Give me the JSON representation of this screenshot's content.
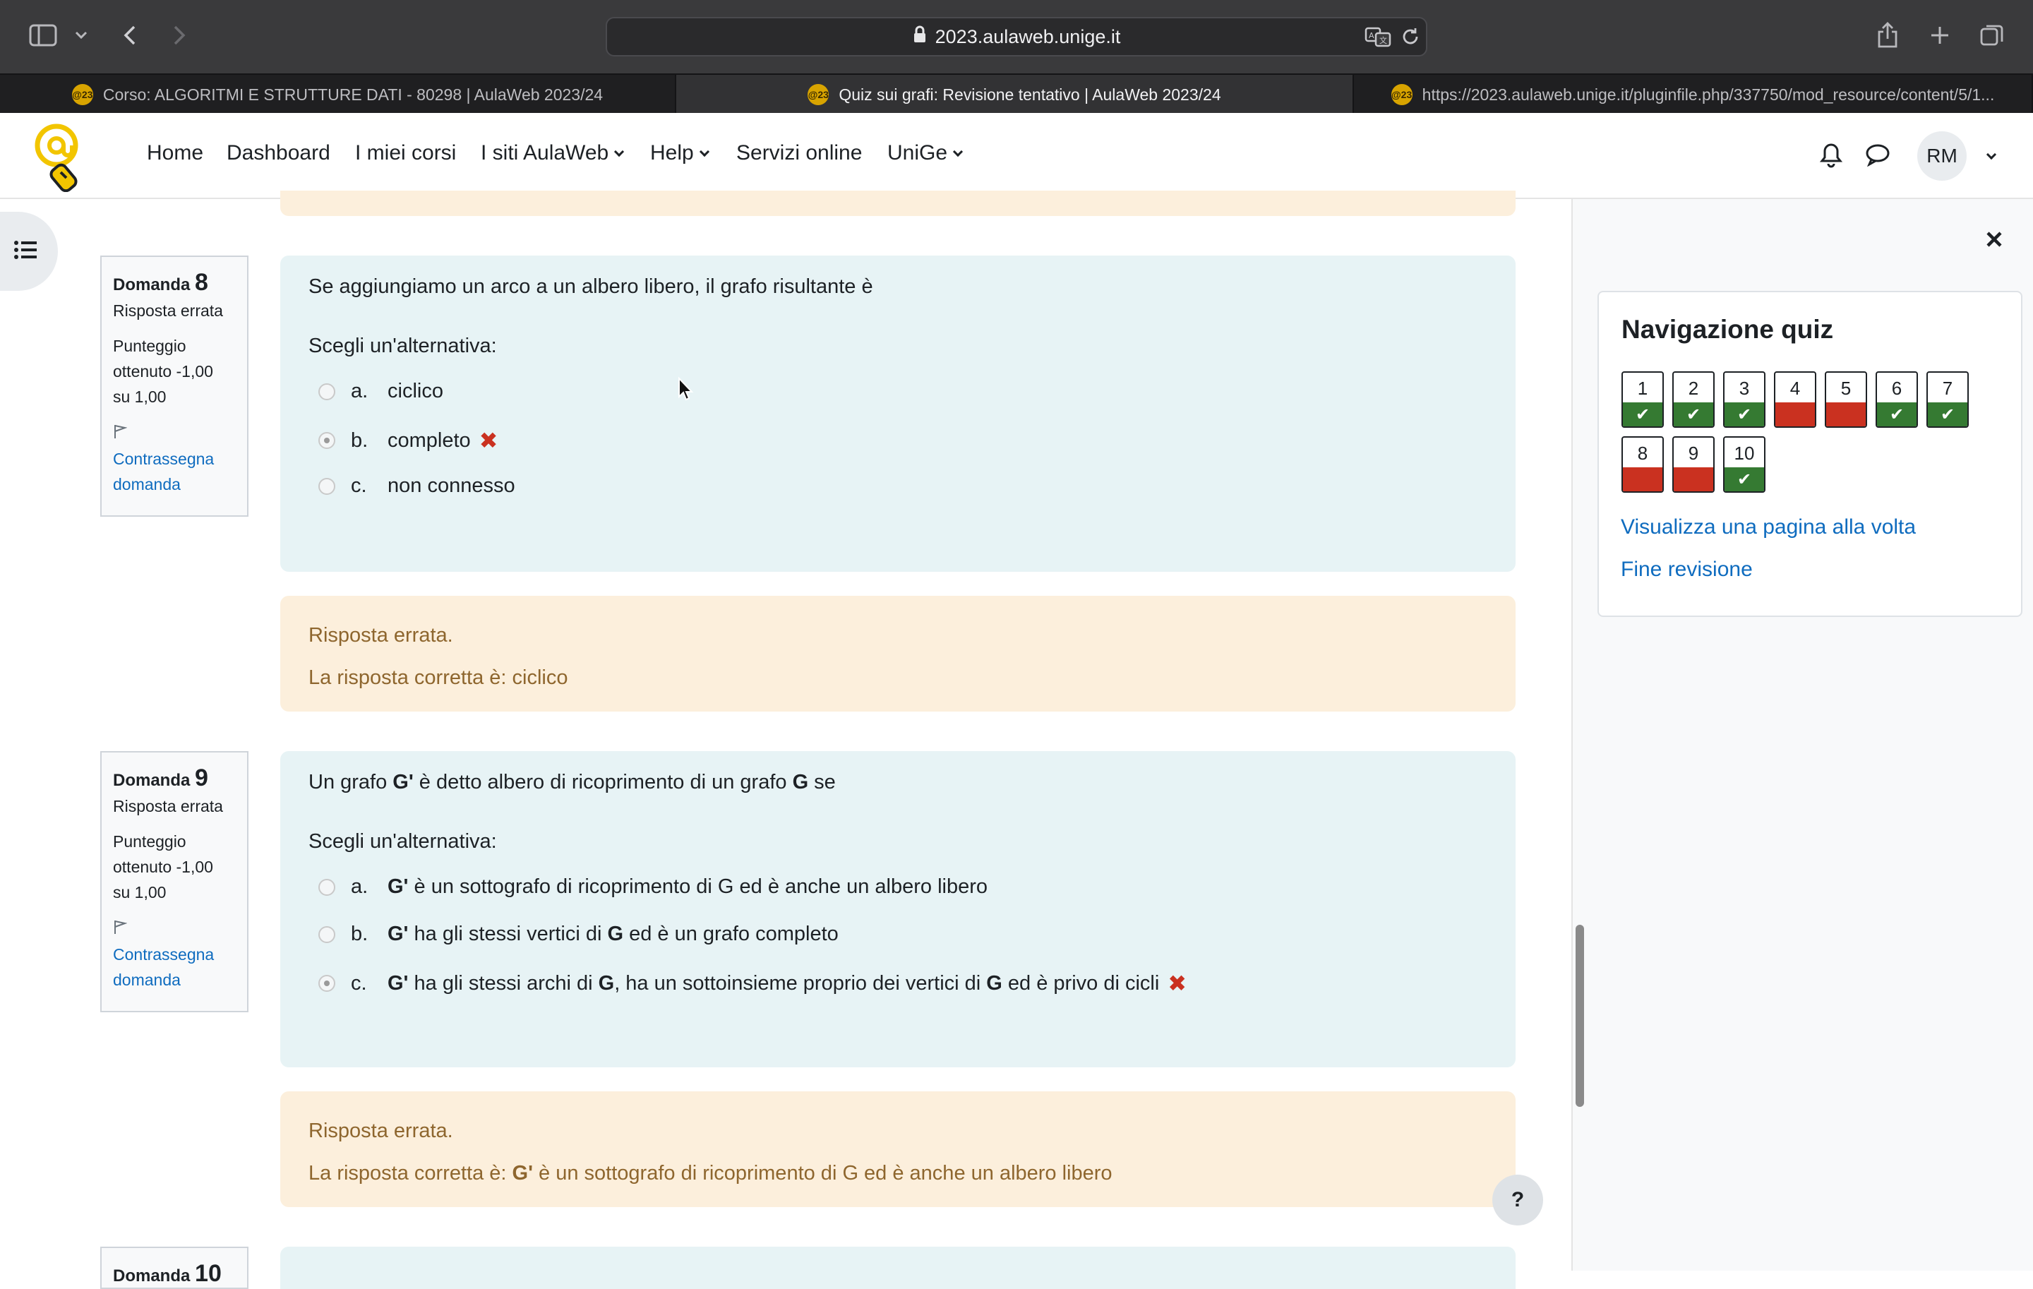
{
  "browser": {
    "url": "2023.aulaweb.unige.it",
    "tabs": [
      {
        "label": "Corso: ALGORITMI E STRUTTURE DATI - 80298 | AulaWeb 2023/24",
        "active": false
      },
      {
        "label": "Quiz sui grafi: Revisione tentativo | AulaWeb 2023/24",
        "active": true
      },
      {
        "label": "https://2023.aulaweb.unige.it/pluginfile.php/337750/mod_resource/content/5/1...",
        "active": false
      }
    ],
    "favicon_text": "@23"
  },
  "navbar": {
    "items": [
      "Home",
      "Dashboard",
      "I miei corsi",
      "I siti AulaWeb",
      "Help",
      "Servizi online",
      "UniGe"
    ],
    "user_initials": "RM"
  },
  "questions": [
    {
      "label": "Domanda",
      "number": "8",
      "state": "Risposta errata",
      "grade_lines": [
        "Punteggio",
        "ottenuto -1,00",
        "su 1,00"
      ],
      "flag_lines": [
        "Contrassegna",
        "domanda"
      ],
      "text": "Se aggiungiamo un arco a un albero libero, il grafo risultante è",
      "prompt": "Scegli un'alternativa:",
      "options": [
        {
          "letter": "a.",
          "text": "ciclico",
          "selected": false
        },
        {
          "letter": "b.",
          "text": "completo",
          "selected": true,
          "wrong": true
        },
        {
          "letter": "c.",
          "text": "non connesso",
          "selected": false
        }
      ],
      "feedback_status": "Risposta errata.",
      "feedback_correct_prefix": "La risposta corretta è: ",
      "feedback_correct": "ciclico"
    },
    {
      "label": "Domanda",
      "number": "9",
      "state": "Risposta errata",
      "grade_lines": [
        "Punteggio",
        "ottenuto -1,00",
        "su 1,00"
      ],
      "flag_lines": [
        "Contrassegna",
        "domanda"
      ],
      "text_parts": [
        "Un grafo ",
        "G'",
        " è detto albero di ricoprimento di un grafo ",
        "G",
        " se"
      ],
      "prompt": "Scegli un'alternativa:",
      "options": [
        {
          "letter": "a.",
          "parts": [
            "G'",
            " è  un sottografo di ricoprimento di G ed è anche un albero libero"
          ],
          "selected": false
        },
        {
          "letter": "b.",
          "parts": [
            "G'",
            " ha gli stessi vertici di ",
            "G",
            " ed è un grafo completo"
          ],
          "selected": false
        },
        {
          "letter": "c.",
          "parts": [
            "G'",
            " ha gli stessi archi di ",
            "G",
            ", ha un sottoinsieme proprio dei vertici di ",
            "G",
            " ed è privo di cicli"
          ],
          "selected": true,
          "wrong": true
        }
      ],
      "feedback_status": "Risposta errata.",
      "feedback_correct_prefix": "La risposta corretta è: ",
      "feedback_correct_bold": "G'",
      "feedback_correct_rest": " è  un sottografo di ricoprimento di G ed è anche un albero libero"
    },
    {
      "label": "Domanda",
      "number": "10"
    }
  ],
  "quiz_nav": {
    "title": "Navigazione quiz",
    "buttons": [
      {
        "number": "1",
        "state": "correct"
      },
      {
        "number": "2",
        "state": "correct"
      },
      {
        "number": "3",
        "state": "correct"
      },
      {
        "number": "4",
        "state": "wrong"
      },
      {
        "number": "5",
        "state": "wrong"
      },
      {
        "number": "6",
        "state": "correct"
      },
      {
        "number": "7",
        "state": "correct"
      },
      {
        "number": "8",
        "state": "wrong"
      },
      {
        "number": "9",
        "state": "wrong"
      },
      {
        "number": "10",
        "state": "correct"
      }
    ],
    "show_one_page": "Visualizza una pagina alla volta",
    "finish_review": "Fine revisione"
  },
  "help_button": "?",
  "colors": {
    "correct": "#357a32",
    "wrong": "#ca3120",
    "link": "#0f6cbf",
    "question_bg": "#e7f3f5",
    "feedback_bg": "#fcefdc"
  }
}
